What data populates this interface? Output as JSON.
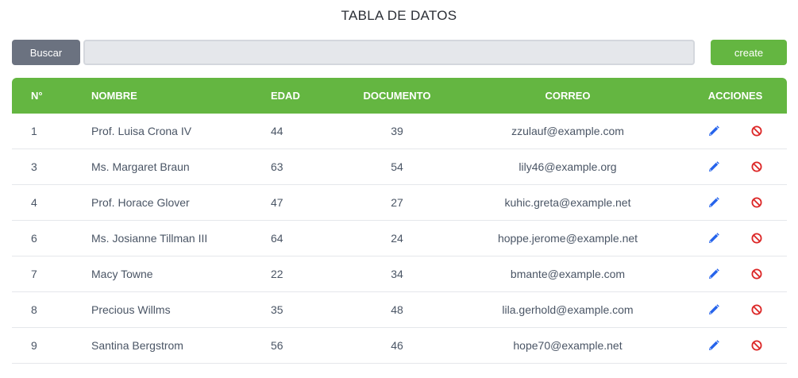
{
  "page": {
    "title": "TABLA DE DATOS"
  },
  "toolbar": {
    "search_button": "Buscar",
    "search_value": "",
    "create_button": "create"
  },
  "table": {
    "headers": {
      "num": "N°",
      "name": "NOMBRE",
      "age": "EDAD",
      "document": "DOCUMENTO",
      "email": "CORREO",
      "actions": "ACCIONES"
    },
    "rows": [
      {
        "num": "1",
        "name": "Prof. Luisa Crona IV",
        "age": "44",
        "document": "39",
        "email": "zzulauf@example.com"
      },
      {
        "num": "3",
        "name": "Ms. Margaret Braun",
        "age": "63",
        "document": "54",
        "email": "lily46@example.org"
      },
      {
        "num": "4",
        "name": "Prof. Horace Glover",
        "age": "47",
        "document": "27",
        "email": "kuhic.greta@example.net"
      },
      {
        "num": "6",
        "name": "Ms. Josianne Tillman III",
        "age": "64",
        "document": "24",
        "email": "hoppe.jerome@example.net"
      },
      {
        "num": "7",
        "name": "Macy Towne",
        "age": "22",
        "document": "34",
        "email": "bmante@example.com"
      },
      {
        "num": "8",
        "name": "Precious Willms",
        "age": "35",
        "document": "48",
        "email": "lila.gerhold@example.com"
      },
      {
        "num": "9",
        "name": "Santina Bergstrom",
        "age": "56",
        "document": "46",
        "email": "hope70@example.net"
      }
    ],
    "row_actions": {
      "edit_icon": "pencil-icon",
      "delete_icon": "ban-icon"
    }
  },
  "colors": {
    "accent_green": "#64b641",
    "search_button_gray": "#6b7280",
    "edit_icon_blue": "#2563eb",
    "delete_icon_red": "#dc2626"
  }
}
